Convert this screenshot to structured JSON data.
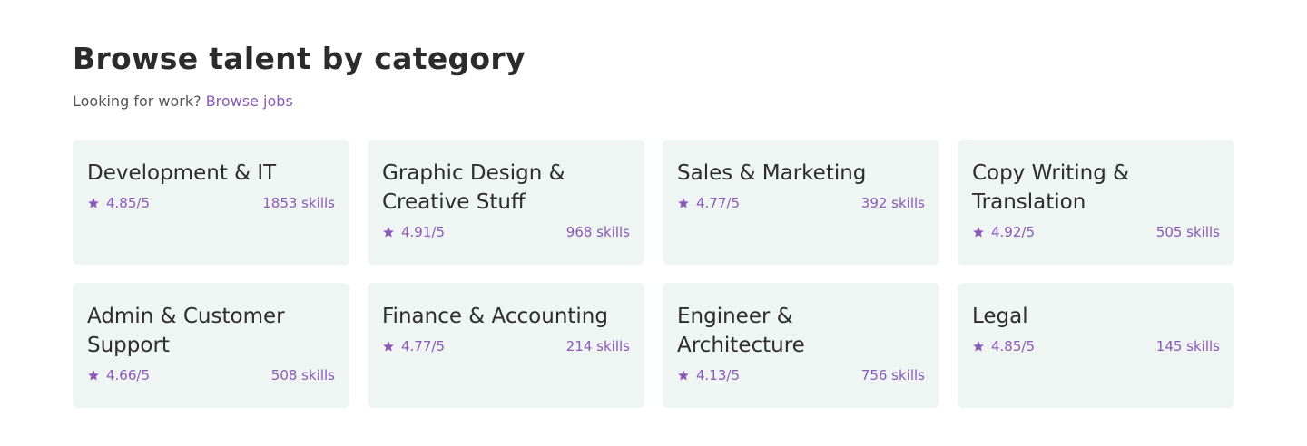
{
  "header": {
    "title": "Browse talent by category",
    "subtitle_text": "Looking for work?",
    "subtitle_link": "Browse jobs"
  },
  "colors": {
    "accent": "#8b5ab8",
    "card_bg": "#eff5f3",
    "text": "#2d2d2d"
  },
  "categories": [
    {
      "title": "Development & IT",
      "rating": "4.85/5",
      "skills": "1853 skills",
      "icon": "star-icon"
    },
    {
      "title": "Graphic Design & Creative Stuff",
      "rating": "4.91/5",
      "skills": "968 skills",
      "icon": "star-icon"
    },
    {
      "title": "Sales & Marketing",
      "rating": "4.77/5",
      "skills": "392 skills",
      "icon": "star-icon"
    },
    {
      "title": "Copy Writing & Translation",
      "rating": "4.92/5",
      "skills": "505 skills",
      "icon": "star-icon"
    },
    {
      "title": "Admin & Customer Support",
      "rating": "4.66/5",
      "skills": "508 skills",
      "icon": "star-icon"
    },
    {
      "title": "Finance & Accounting",
      "rating": "4.77/5",
      "skills": "214 skills",
      "icon": "star-icon"
    },
    {
      "title": "Engineer & Architecture",
      "rating": "4.13/5",
      "skills": "756 skills",
      "icon": "star-icon"
    },
    {
      "title": "Legal",
      "rating": "4.85/5",
      "skills": "145 skills",
      "icon": "star-icon"
    }
  ]
}
